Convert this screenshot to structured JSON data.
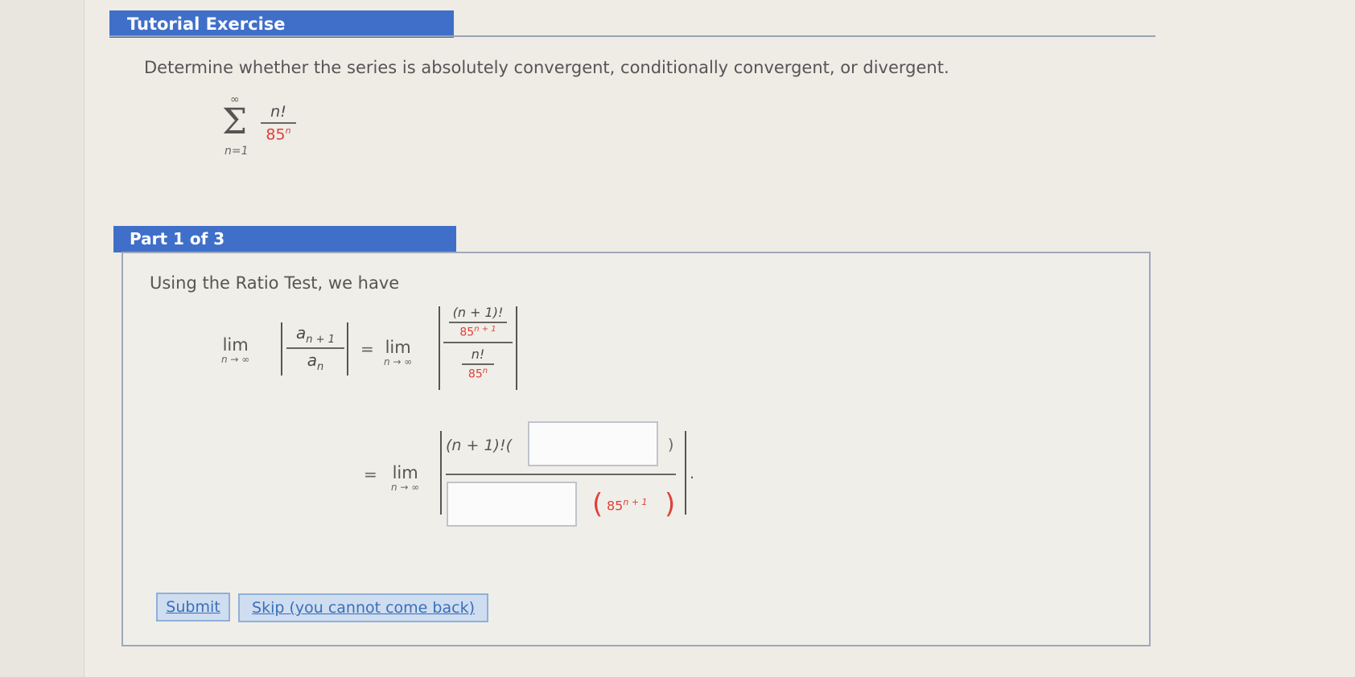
{
  "tutorial": {
    "title": "Tutorial Exercise"
  },
  "question": {
    "text": "Determine whether the series is absolutely convergent, conditionally convergent, or divergent."
  },
  "series": {
    "sigma": "Σ",
    "upper": "∞",
    "lower": "n=1",
    "numerator": "n!",
    "denominator_base": "85",
    "denominator_exp": "n"
  },
  "part": {
    "title": "Part 1 of 3",
    "intro": "Using the Ratio Test, we have",
    "lim_word": "lim",
    "lim_sub": "n → ∞",
    "equals": "=",
    "ratio_num": "a",
    "ratio_num_sub": "n + 1",
    "ratio_den": "a",
    "ratio_den_sub": "n",
    "top_num": "(n + 1)!",
    "top_den_base": "85",
    "top_den_exp": "n + 1",
    "bot_num": "n!",
    "bot_den_base": "85",
    "bot_den_exp": "n",
    "step2_num_prefix": "(n + 1)!(",
    "step2_num_suffix": ")",
    "step2_den_paren_open": "(",
    "step2_den_base": "85",
    "step2_den_exp": "n + 1",
    "step2_den_paren_close": ")",
    "trailing_dot": "."
  },
  "inputs": {
    "numerator_blank": "",
    "denominator_blank": ""
  },
  "buttons": {
    "submit": "Submit",
    "skip": "Skip (you cannot come back)"
  },
  "colors": {
    "header_blue": "#3f6fc9",
    "accent_red": "#e0403a",
    "button_bg": "#cfddf0"
  }
}
